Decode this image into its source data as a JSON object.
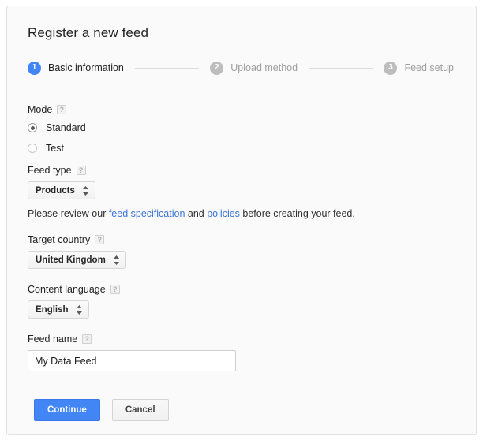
{
  "page": {
    "title": "Register a new feed"
  },
  "stepper": {
    "steps": [
      {
        "number": "1",
        "label": "Basic information",
        "state": "active"
      },
      {
        "number": "2",
        "label": "Upload method",
        "state": "inactive"
      },
      {
        "number": "3",
        "label": "Feed setup",
        "state": "inactive"
      }
    ]
  },
  "mode": {
    "label": "Mode",
    "help": "?",
    "options": [
      {
        "label": "Standard",
        "selected": true
      },
      {
        "label": "Test",
        "selected": false
      }
    ]
  },
  "feed_type": {
    "label": "Feed type",
    "help": "?",
    "value": "Products"
  },
  "note": {
    "before": "Please review our ",
    "link1": "feed specification",
    "middle": " and ",
    "link2": "policies",
    "after": " before creating your feed."
  },
  "target_country": {
    "label": "Target country",
    "help": "?",
    "value": "United Kingdom"
  },
  "content_language": {
    "label": "Content language",
    "help": "?",
    "value": "English"
  },
  "feed_name": {
    "label": "Feed name",
    "help": "?",
    "value": "My Data Feed",
    "placeholder": ""
  },
  "actions": {
    "continue_label": "Continue",
    "cancel_label": "Cancel"
  },
  "colors": {
    "accent": "#4285f4",
    "link": "#3b73d6",
    "step_inactive": "#bdbdbd",
    "card_bg": "#fafafa",
    "border": "#e0e0e0"
  }
}
